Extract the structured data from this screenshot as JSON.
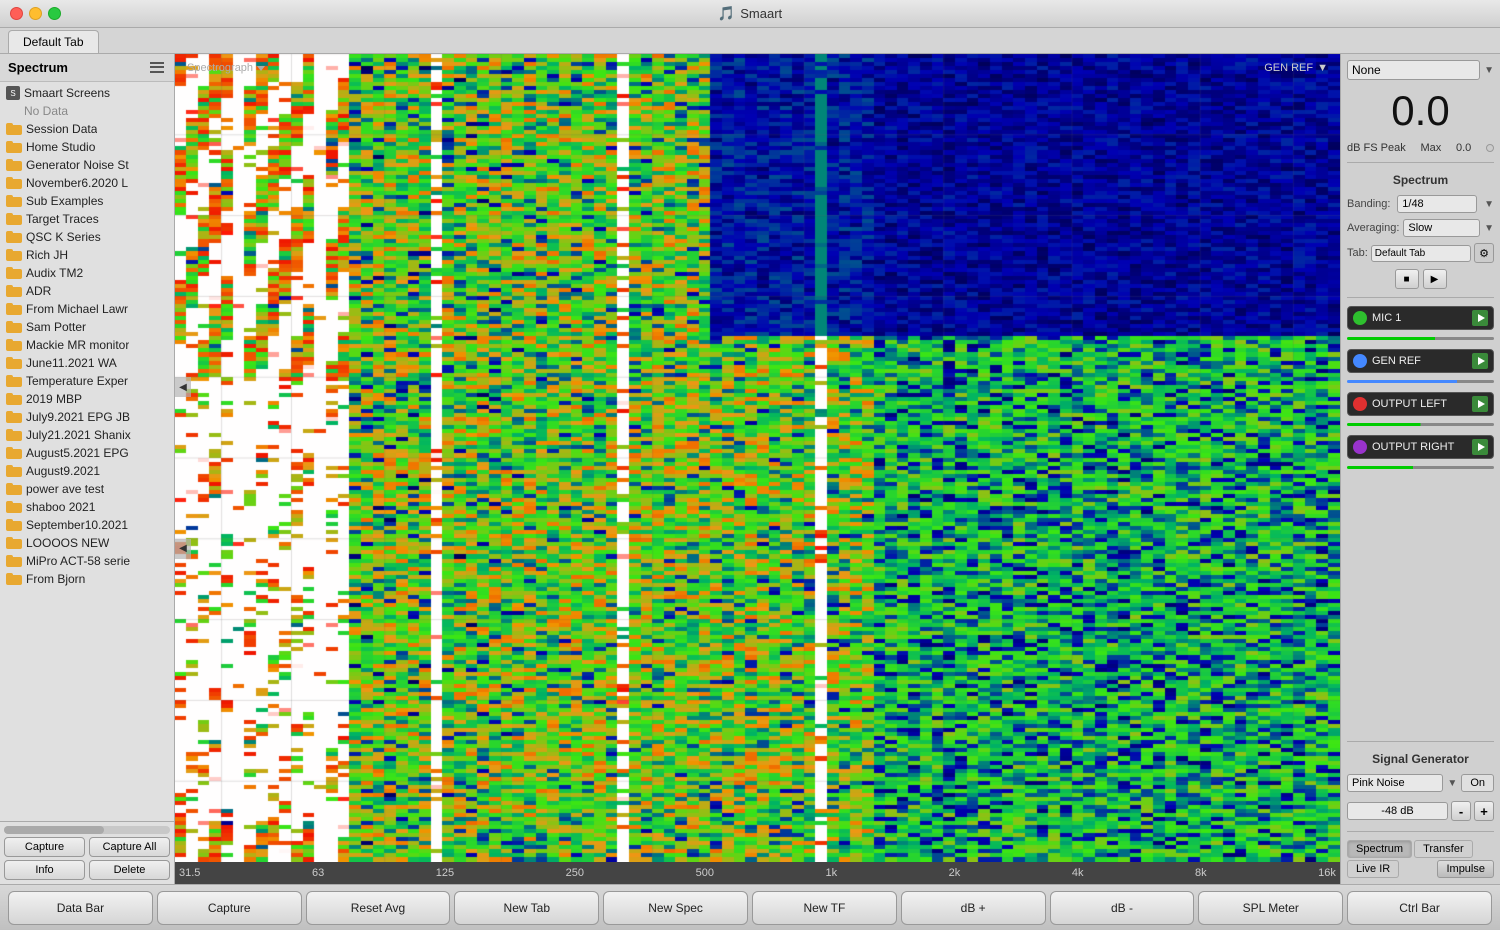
{
  "titleBar": {
    "title": "Smaart",
    "appIcon": "🎵"
  },
  "tabs": [
    {
      "label": "Default Tab"
    }
  ],
  "sidebar": {
    "title": "Spectrum",
    "items": [
      {
        "id": "smaart-screens",
        "type": "smaart",
        "label": "Smaart Screens",
        "children": [
          {
            "id": "no-data",
            "type": "nodata",
            "label": "No Data"
          }
        ]
      },
      {
        "id": "session-data",
        "type": "folder",
        "label": "Session Data"
      },
      {
        "id": "home-studio",
        "type": "folder",
        "label": "Home Studio"
      },
      {
        "id": "generator-noise",
        "type": "folder",
        "label": "Generator Noise St"
      },
      {
        "id": "november",
        "type": "folder",
        "label": "November6.2020 L"
      },
      {
        "id": "sub-examples",
        "type": "folder",
        "label": "Sub Examples"
      },
      {
        "id": "target-traces",
        "type": "folder",
        "label": "Target Traces"
      },
      {
        "id": "qsc-k",
        "type": "folder",
        "label": "QSC K Series"
      },
      {
        "id": "rich-jh",
        "type": "folder",
        "label": "Rich JH"
      },
      {
        "id": "audix-tm2",
        "type": "folder",
        "label": "Audix TM2"
      },
      {
        "id": "adr",
        "type": "folder",
        "label": "ADR"
      },
      {
        "id": "from-michael",
        "type": "folder",
        "label": "From Michael Lawr"
      },
      {
        "id": "sam-potter",
        "type": "folder",
        "label": "Sam Potter"
      },
      {
        "id": "mackie-mr",
        "type": "folder",
        "label": "Mackie MR monitor"
      },
      {
        "id": "june11",
        "type": "folder",
        "label": "June11.2021 WA"
      },
      {
        "id": "temperature",
        "type": "folder",
        "label": "Temperature Exper"
      },
      {
        "id": "2019-mbp",
        "type": "folder",
        "label": "2019 MBP"
      },
      {
        "id": "july9",
        "type": "folder",
        "label": "July9.2021 EPG JB"
      },
      {
        "id": "july21",
        "type": "folder",
        "label": "July21.2021 Shanix"
      },
      {
        "id": "august5",
        "type": "folder",
        "label": "August5.2021 EPG"
      },
      {
        "id": "august9",
        "type": "folder",
        "label": "August9.2021"
      },
      {
        "id": "power-ave",
        "type": "folder",
        "label": "power ave test"
      },
      {
        "id": "shaboo",
        "type": "folder",
        "label": "shaboo 2021"
      },
      {
        "id": "september10",
        "type": "folder",
        "label": "September10.2021"
      },
      {
        "id": "loooos",
        "type": "folder",
        "label": "LOOOOS NEW"
      },
      {
        "id": "mipro",
        "type": "folder",
        "label": "MiPro ACT-58 serie"
      },
      {
        "id": "from-bjorn",
        "type": "folder",
        "label": "From Bjorn"
      }
    ],
    "buttons": {
      "capture": "Capture",
      "captureAll": "Capture All",
      "info": "Info",
      "delete": "Delete"
    }
  },
  "spectrograph": {
    "label": "Spectrograph",
    "genref": "GEN REF"
  },
  "frequencyAxis": {
    "labels": [
      "31.5",
      "63",
      "125",
      "250",
      "500",
      "1k",
      "2k",
      "4k",
      "8k",
      "16k"
    ]
  },
  "rightPanel": {
    "levelSelect": "None",
    "levelValue": "0.0",
    "levelUnit": "dB FS Peak",
    "maxLabel": "Max",
    "maxValue": "0.0",
    "spectrum": {
      "sectionLabel": "Spectrum",
      "banding": {
        "label": "Banding:",
        "value": "1/48"
      },
      "averaging": {
        "label": "Averaging:",
        "value": "Slow"
      },
      "tab": {
        "label": "Tab:",
        "value": "Default Tab"
      }
    },
    "channels": [
      {
        "id": "mic1",
        "name": "MIC 1",
        "color": "#2ec02e",
        "meterWidth": "60%"
      },
      {
        "id": "genref",
        "name": "GEN REF",
        "color": "#4488ff",
        "meterWidth": "75%"
      },
      {
        "id": "output-left",
        "name": "OUTPUT LEFT",
        "color": "#e03030",
        "meterWidth": "50%"
      },
      {
        "id": "output-right",
        "name": "OUTPUT RIGHT",
        "color": "#9933cc",
        "meterWidth": "45%"
      }
    ],
    "signalGenerator": {
      "sectionLabel": "Signal Generator",
      "type": "Pink Noise",
      "onLabel": "On",
      "dbValue": "-48 dB",
      "minusLabel": "-",
      "plusLabel": "+"
    },
    "analysisTabs": {
      "spectrum": "Spectrum",
      "transfer": "Transfer",
      "liveIR": "Live IR",
      "impulse": "Impulse"
    }
  },
  "toolbar": {
    "buttons": [
      {
        "id": "data-bar",
        "label": "Data Bar"
      },
      {
        "id": "capture",
        "label": "Capture"
      },
      {
        "id": "reset-avg",
        "label": "Reset Avg"
      },
      {
        "id": "new-tab",
        "label": "New Tab"
      },
      {
        "id": "new-spec",
        "label": "New Spec"
      },
      {
        "id": "new-tf",
        "label": "New TF"
      },
      {
        "id": "db-plus",
        "label": "dB +"
      },
      {
        "id": "db-minus",
        "label": "dB -"
      },
      {
        "id": "spl-meter",
        "label": "SPL Meter"
      },
      {
        "id": "ctrl-bar",
        "label": "Ctrl Bar"
      }
    ]
  }
}
